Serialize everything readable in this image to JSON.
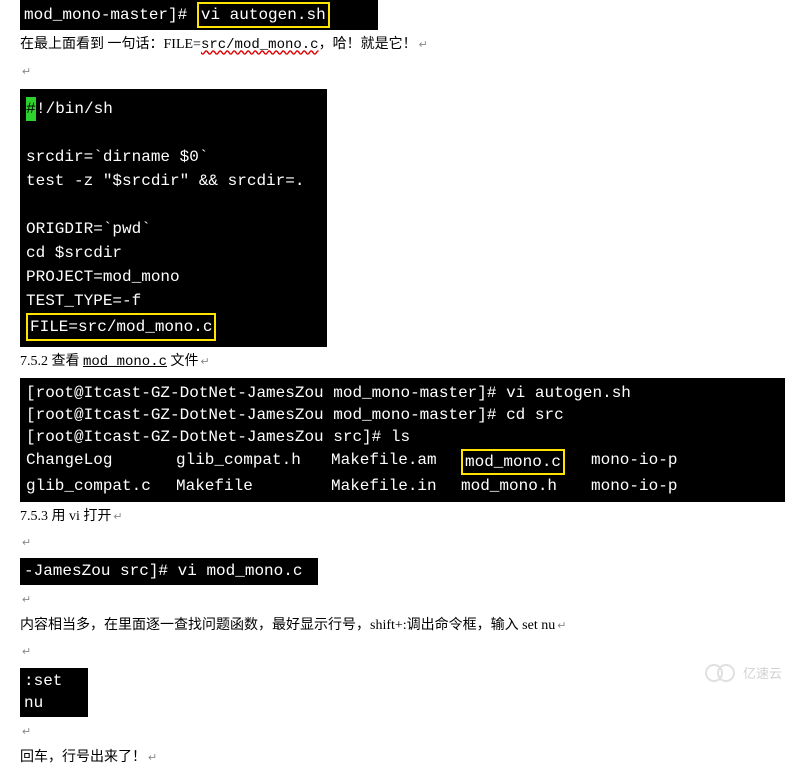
{
  "row1": {
    "prefix": "mod_mono-master]#",
    "cmd": "vi autogen.sh"
  },
  "line1": {
    "a": "在最上面看到 一句话：FILE=",
    "b": "src/mod_mono.c",
    "c": "，哈！就是它！"
  },
  "block1": {
    "shebang_hash": "#",
    "shebang_rest": "!/bin/sh",
    "l1": "srcdir=`dirname $0`",
    "l2": "test -z \"$srcdir\" && srcdir=.",
    "l3": "ORIGDIR=`pwd`",
    "l4": "cd $srcdir",
    "l5": "PROJECT=mod_mono",
    "l6": "TEST_TYPE=-f",
    "l7": "FILE=src/mod_mono.c"
  },
  "sec752": {
    "a": "7.5.2 查看 ",
    "b": "mod_mono.c",
    "c": " 文件"
  },
  "block2": {
    "l1": "[root@Itcast-GZ-DotNet-JamesZou mod_mono-master]# vi autogen.sh",
    "l2": "[root@Itcast-GZ-DotNet-JamesZou mod_mono-master]# cd src",
    "l3": "[root@Itcast-GZ-DotNet-JamesZou src]# ls",
    "cols1": [
      "ChangeLog",
      "glib_compat.h",
      "Makefile.am"
    ],
    "boxed": "mod_mono.c",
    "tail1": "mono-io-p",
    "cols2": [
      "glib_compat.c",
      "Makefile",
      "Makefile.in",
      "mod_mono.h",
      "mono-io-p"
    ]
  },
  "sec753": "7.5.3 用 vi 打开",
  "row2": {
    "prefix": "-JamesZou src]#",
    "cmd": " vi mod_mono.c"
  },
  "line2": "内容相当多，在里面逐一查找问题函数，最好显示行号，shift+:调出命令框，输入 set nu",
  "row3": ":set nu",
  "line3": "回车，行号出来了！",
  "watermark": "亿速云"
}
